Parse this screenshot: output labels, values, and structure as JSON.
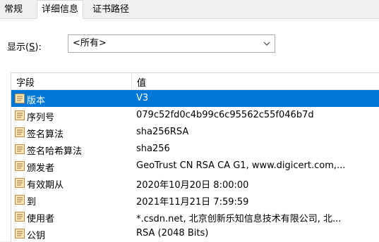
{
  "tabs": [
    "常规",
    "详细信息",
    "证书路径"
  ],
  "show": {
    "label_prefix": "显示(",
    "label_key": "S",
    "label_suffix": "):",
    "value": "<所有>"
  },
  "columns": {
    "field": "字段",
    "value": "值"
  },
  "rows": [
    {
      "field": "版本",
      "value": "V3"
    },
    {
      "field": "序列号",
      "value": "079c52fd0c4b99c6c95562c55f046b7d"
    },
    {
      "field": "签名算法",
      "value": "sha256RSA"
    },
    {
      "field": "签名哈希算法",
      "value": "sha256"
    },
    {
      "field": "颁发者",
      "value": "GeoTrust CN RSA CA G1, www.digicert.com,..."
    },
    {
      "field": "有效期从",
      "value": "2020年10月20日 8:00:00"
    },
    {
      "field": "到",
      "value": "2021年11月21日 7:59:59"
    },
    {
      "field": "使用者",
      "value": "*.csdn.net, 北京创新乐知信息技术有限公司, 北..."
    },
    {
      "field": "公钥",
      "value": "RSA (2048 Bits)"
    }
  ],
  "selected_row": 0,
  "colors": {
    "selection": "#0078d7",
    "icon_border": "#c28a3a",
    "icon_fill": "#f6e3b8"
  },
  "icons": {
    "row": "certificate-field-icon",
    "dropdown": "chevron-down-icon"
  }
}
